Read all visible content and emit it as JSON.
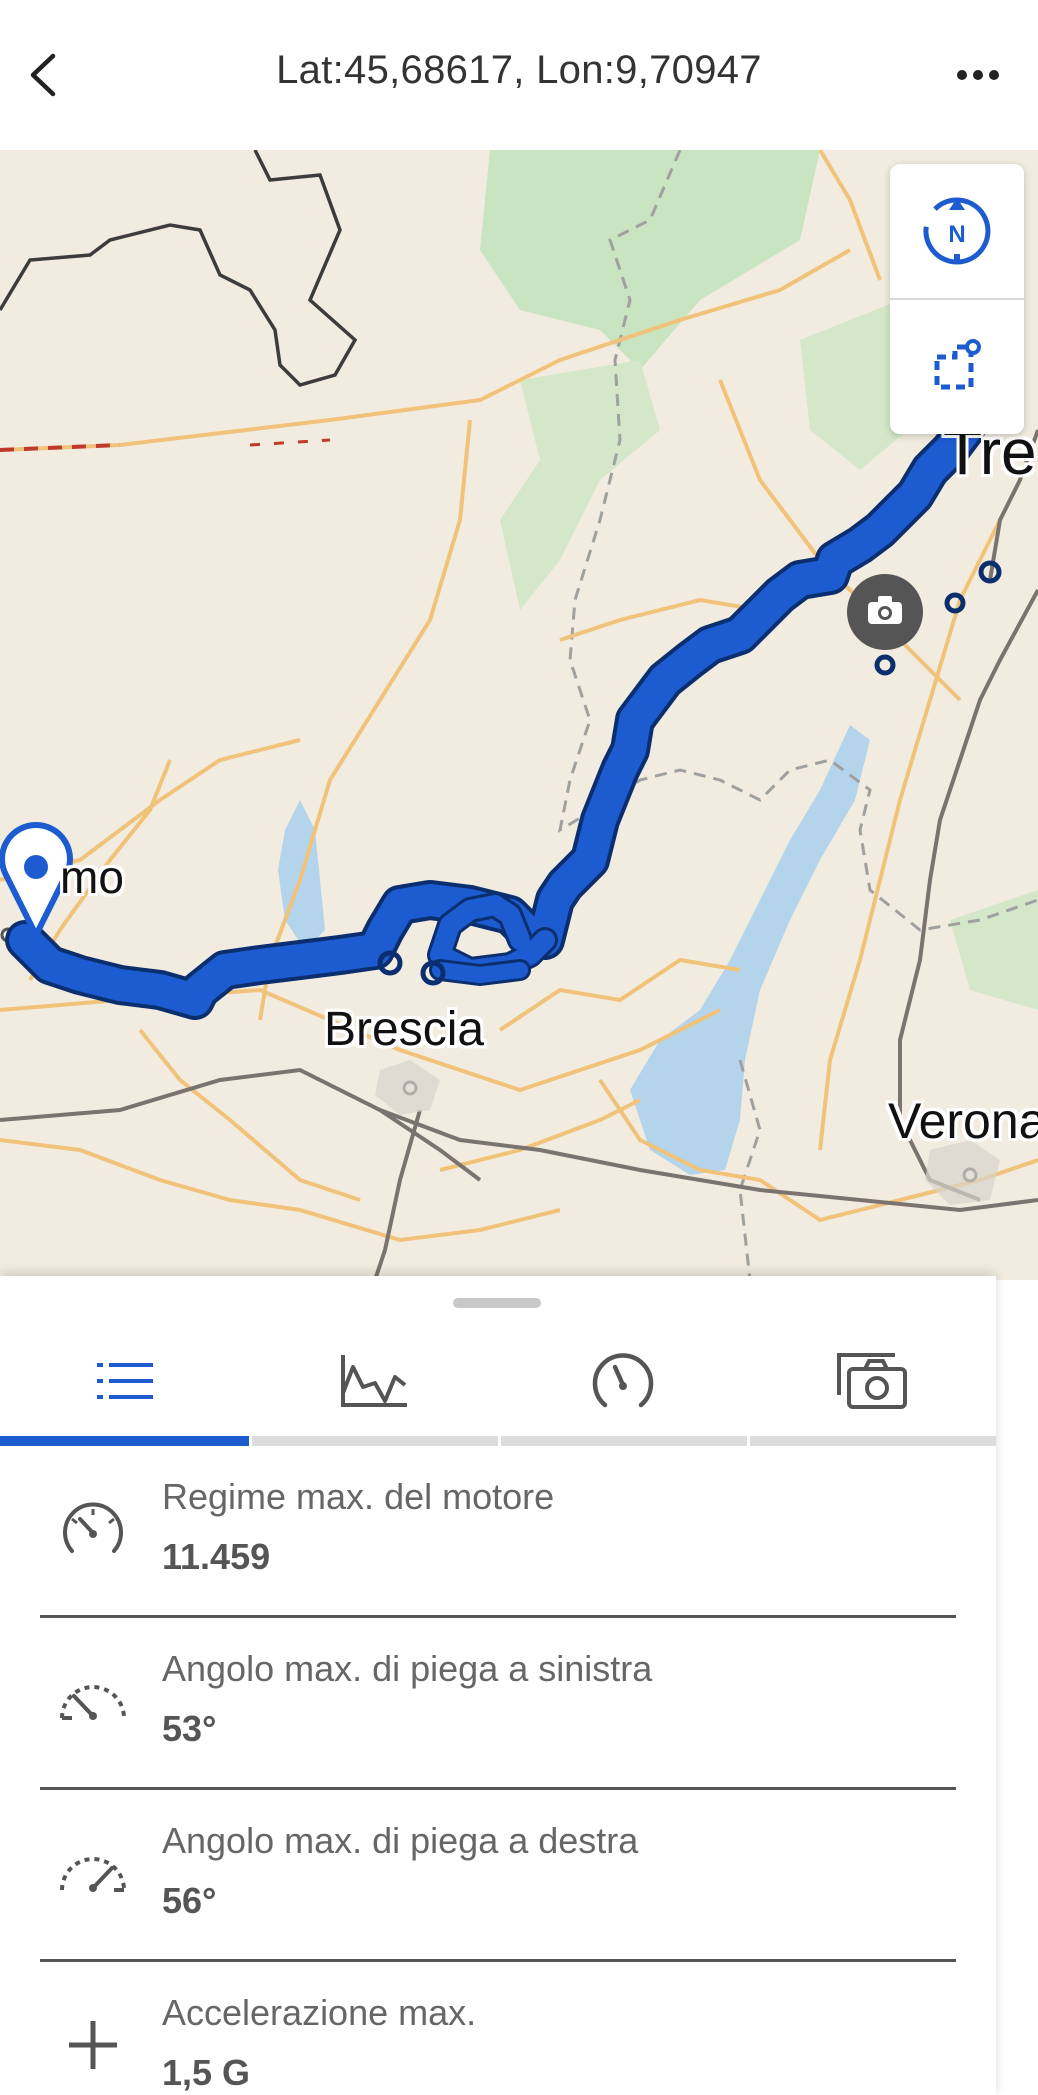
{
  "header": {
    "title": "Lat:45,68617, Lon:9,70947"
  },
  "map": {
    "labels": {
      "bergamo_partial": "mo",
      "brescia": "Brescia",
      "verona": "Verona",
      "trento_partial": "Tre",
      "right_edge_partial": "na"
    },
    "controls": {
      "compass_letter": "N"
    },
    "colors": {
      "route": "#1c5bd0",
      "route_outline": "#0b2f6e",
      "water": "#b4d4ec",
      "forest": "#c9e4c0",
      "land": "#f1ecdf"
    }
  },
  "panel": {
    "tabs": [
      {
        "name": "tab-list",
        "icon": "list-icon",
        "active": true
      },
      {
        "name": "tab-chart",
        "icon": "elevation-chart-icon",
        "active": false
      },
      {
        "name": "tab-speed",
        "icon": "speedometer-icon",
        "active": false
      },
      {
        "name": "tab-photos",
        "icon": "camera-icon",
        "active": false
      }
    ],
    "stats": [
      {
        "label": "Regime max. del motore",
        "value": "11.459",
        "icon": "rpm-gauge-icon"
      },
      {
        "label": "Angolo max. di piega a sinistra",
        "value": "53°",
        "icon": "lean-left-icon"
      },
      {
        "label": "Angolo max. di piega a destra",
        "value": "56°",
        "icon": "lean-right-icon"
      },
      {
        "label": "Accelerazione max.",
        "value": "1,5 G",
        "icon": "plus-icon"
      }
    ]
  }
}
